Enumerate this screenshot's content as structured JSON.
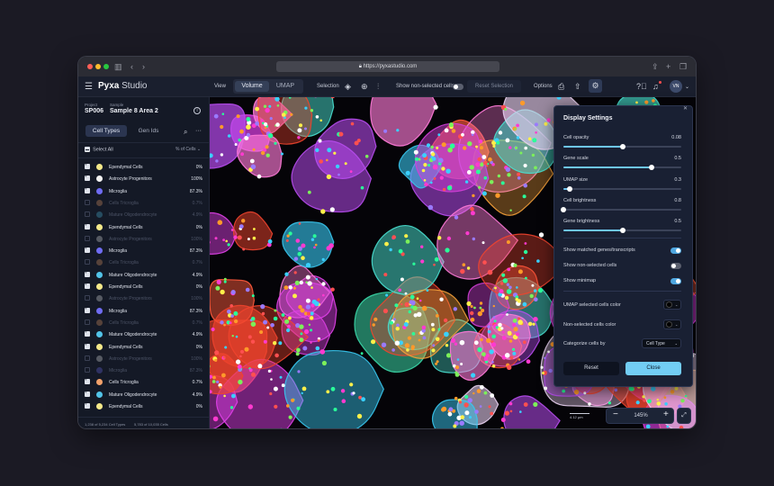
{
  "browser": {
    "url": "https://pyxastudio.com"
  },
  "app": {
    "logo_text": "Pyxa",
    "logo_suffix": "Studio",
    "view_label": "View",
    "view_tabs": [
      {
        "label": "Volume",
        "active": true
      },
      {
        "label": "UMAP",
        "active": false
      }
    ],
    "selection_label": "Selection",
    "show_non_selected_label": "Show non-selected cells",
    "reset_selection_label": "Reset Selection",
    "options_label": "Options",
    "avatar_initials": "VN"
  },
  "sidebar": {
    "project_label": "Project",
    "project_value": "SP006",
    "sample_label": "Sample",
    "sample_value": "Sample 8 Area 2",
    "tabs": [
      {
        "label": "Cell Types",
        "active": true
      },
      {
        "label": "Gen Ids",
        "active": false
      }
    ],
    "select_all_label": "Select All",
    "sort_label": "% of Cells",
    "rows": [
      {
        "name": "Ependymal Cells",
        "pct": "0%",
        "color": "#f4e98a",
        "checked": true
      },
      {
        "name": "Astrocyte Progenitors",
        "pct": "100%",
        "color": "#f2f2f2",
        "checked": true
      },
      {
        "name": "Microglia",
        "pct": "87.3%",
        "color": "#6f6cf2",
        "checked": true
      },
      {
        "name": "Cells Tricroglia",
        "pct": "0.7%",
        "color": "#f2a26b",
        "checked": false
      },
      {
        "name": "Mature Oligodendrocyte",
        "pct": "4.9%",
        "color": "#52c3e8",
        "checked": false
      },
      {
        "name": "Ependymal Cells",
        "pct": "0%",
        "color": "#f4e98a",
        "checked": true
      },
      {
        "name": "Astrocyte Progenitors",
        "pct": "100%",
        "color": "#f2f2f2",
        "checked": false
      },
      {
        "name": "Microglia",
        "pct": "87.3%",
        "color": "#6f6cf2",
        "checked": true
      },
      {
        "name": "Cells Tricroglia",
        "pct": "0.7%",
        "color": "#f2a26b",
        "checked": false
      },
      {
        "name": "Mature Oligodendrocyte",
        "pct": "4.9%",
        "color": "#52c3e8",
        "checked": true
      },
      {
        "name": "Ependymal Cells",
        "pct": "0%",
        "color": "#f4e98a",
        "checked": true
      },
      {
        "name": "Astrocyte Progenitors",
        "pct": "100%",
        "color": "#f2f2f2",
        "checked": false
      },
      {
        "name": "Microglia",
        "pct": "87.3%",
        "color": "#6f6cf2",
        "checked": true
      },
      {
        "name": "Cells Tricroglia",
        "pct": "0.7%",
        "color": "#f2a26b",
        "checked": false
      },
      {
        "name": "Mature Oligodendrocyte",
        "pct": "4.9%",
        "color": "#52c3e8",
        "checked": true
      },
      {
        "name": "Ependymal Cells",
        "pct": "0%",
        "color": "#f4e98a",
        "checked": true
      },
      {
        "name": "Astrocyte Progenitors",
        "pct": "100%",
        "color": "#f2f2f2",
        "checked": false
      },
      {
        "name": "Microglia",
        "pct": "87.3%",
        "color": "#6f6cf2",
        "checked": false
      },
      {
        "name": "Cells Tricroglia",
        "pct": "0.7%",
        "color": "#f2a26b",
        "checked": true
      },
      {
        "name": "Mature Oligodendrocyte",
        "pct": "4.9%",
        "color": "#52c3e8",
        "checked": true
      },
      {
        "name": "Ependymal Cells",
        "pct": "0%",
        "color": "#f4e98a",
        "checked": true
      }
    ],
    "footer_left": "1,238 of 5,234 Cell Types",
    "footer_right": "5,783 of 10,035 Cells"
  },
  "display_settings": {
    "title": "Display Settings",
    "sliders": [
      {
        "label": "Cell opacity",
        "value": "0.08",
        "fraction": 0.5
      },
      {
        "label": "Gene scale",
        "value": "0.5",
        "fraction": 0.75
      },
      {
        "label": "UMAP size",
        "value": "0.3",
        "fraction": 0.05
      },
      {
        "label": "Cell brightness",
        "value": "0.8",
        "fraction": 0.0
      },
      {
        "label": "Gene brightness",
        "value": "0.5",
        "fraction": 0.5
      }
    ],
    "toggles": [
      {
        "label": "Show matched genes/transcripts",
        "on": true
      },
      {
        "label": "Show non-selected cells",
        "on": false
      },
      {
        "label": "Show minimap",
        "on": true
      }
    ],
    "umap_selected_color_label": "UMAP selected cells color",
    "non_selected_color_label": "Non-selected cells color",
    "categorize_label": "Categorize cells by",
    "categorize_value": "Cell Type",
    "reset_label": "Reset",
    "close_label": "Close"
  },
  "viewer": {
    "zoom_value": "145%",
    "scale_label": "4.12 µm"
  }
}
